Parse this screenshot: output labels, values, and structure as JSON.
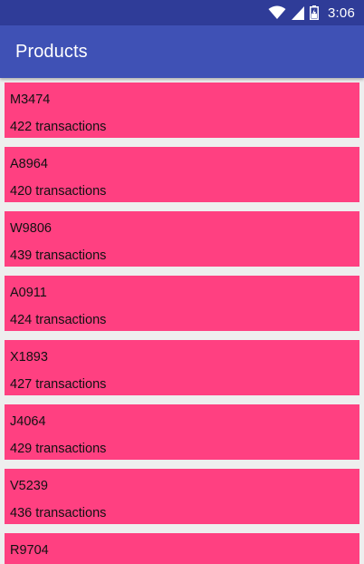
{
  "status_bar": {
    "time": "3:06"
  },
  "app_bar": {
    "title": "Products"
  },
  "products": [
    {
      "name": "M3474",
      "count": "422 transactions"
    },
    {
      "name": "A8964",
      "count": "420 transactions"
    },
    {
      "name": "W9806",
      "count": "439 transactions"
    },
    {
      "name": "A0911",
      "count": "424 transactions"
    },
    {
      "name": "X1893",
      "count": "427 transactions"
    },
    {
      "name": "J4064",
      "count": "429 transactions"
    },
    {
      "name": "V5239",
      "count": "436 transactions"
    },
    {
      "name": "R9704",
      "count": ""
    }
  ],
  "colors": {
    "status_bar": "#2f3c98",
    "app_bar": "#3f51b5",
    "card": "#ff4081",
    "background": "#eeeeee"
  },
  "icons": [
    "wifi-icon",
    "cell-signal-icon",
    "battery-icon"
  ]
}
